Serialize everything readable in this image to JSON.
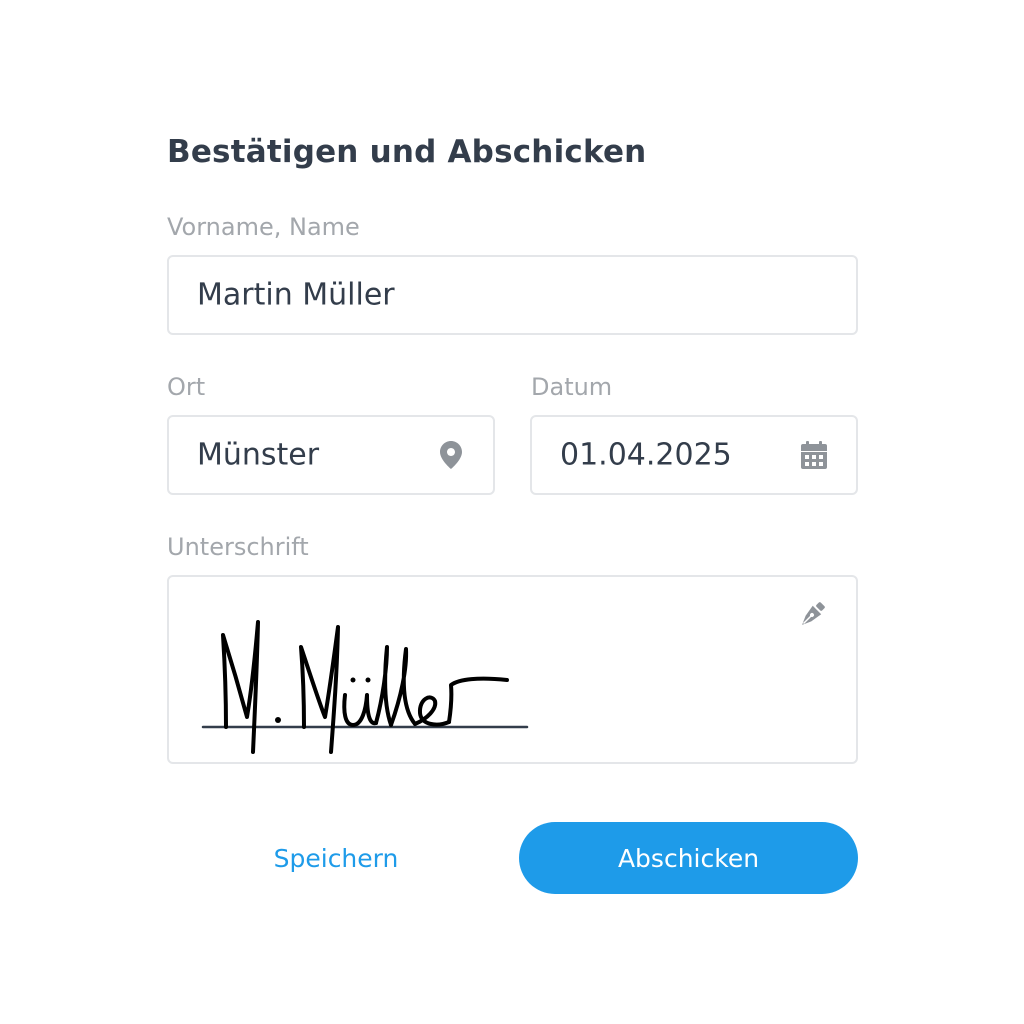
{
  "form": {
    "title": "Bestätigen und Abschicken",
    "name": {
      "label": "Vorname, Name",
      "value": "Martin Müller"
    },
    "place": {
      "label": "Ort",
      "value": "Münster",
      "icon": "location-pin-icon"
    },
    "date": {
      "label": "Datum",
      "value": "01.04.2025",
      "icon": "calendar-icon"
    },
    "signature": {
      "label": "Unterschrift",
      "icon": "pen-nib-icon",
      "handwritten_text": "M. Müller"
    }
  },
  "actions": {
    "save_label": "Speichern",
    "submit_label": "Abschicken"
  },
  "colors": {
    "accent": "#1e9be9",
    "text": "#333d4b",
    "label": "#a3a7ac",
    "border": "#e4e6e9",
    "icon": "#8e9399"
  }
}
